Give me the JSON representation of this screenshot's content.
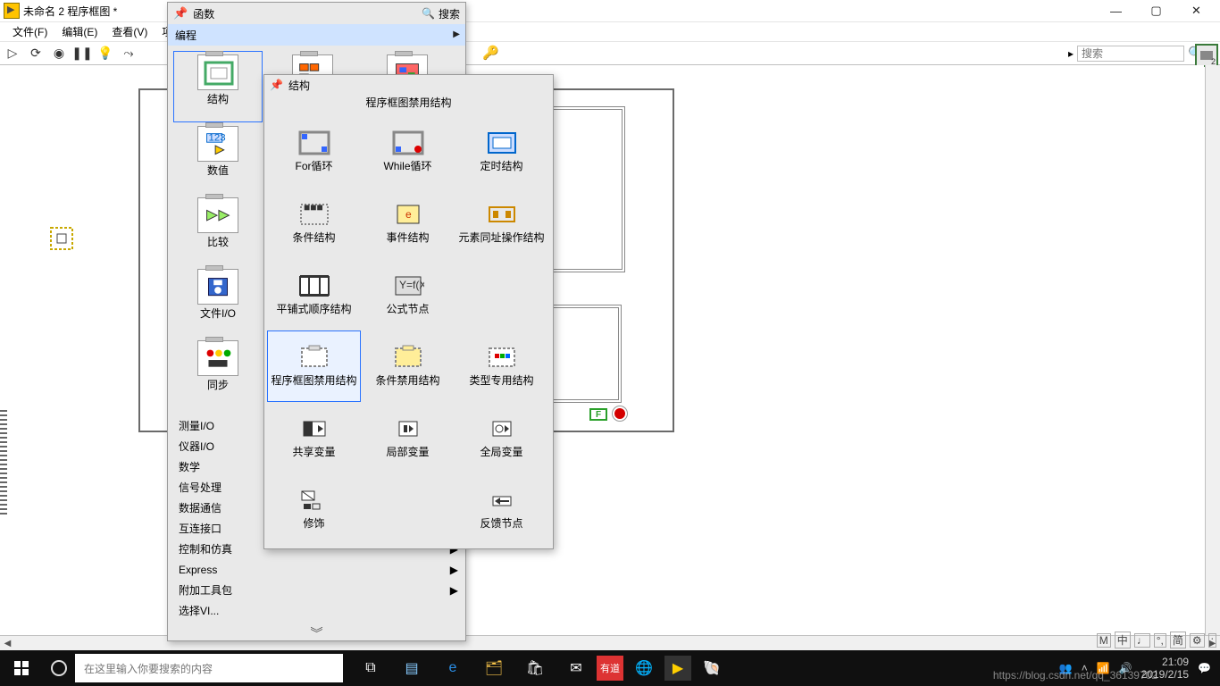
{
  "window": {
    "title": "未命名 2 程序框图 *",
    "min": "—",
    "max": "▢",
    "close": "✕"
  },
  "menubar": {
    "file": "文件(F)",
    "edit": "编辑(E)",
    "view": "查看(V)",
    "project": "项目"
  },
  "toolbar": {
    "search_placeholder": "搜索"
  },
  "palette": {
    "title": "函数",
    "search_label": "搜索",
    "programming": "编程",
    "rows": {
      "struct": "结构",
      "numeric": "数值",
      "compare": "比较",
      "fileio": "文件I/O",
      "sync": "同步"
    },
    "cats": {
      "measio": "测量I/O",
      "instrio": "仪器I/O",
      "math": "数学",
      "signal": "信号处理",
      "datacomm": "数据通信",
      "connectivity": "互连接口",
      "ctrlsim": "控制和仿真",
      "express": "Express",
      "addons": "附加工具包",
      "selectvi": "选择VI..."
    }
  },
  "subpalette": {
    "title": "结构",
    "subtitle": "程序框图禁用结构",
    "items": {
      "for": "For循环",
      "while": "While循环",
      "timed": "定时结构",
      "cond": "条件结构",
      "event": "事件结构",
      "inplace": "元素同址操作结构",
      "flatseq": "平铺式顺序结构",
      "formula": "公式节点",
      "disable": "程序框图禁用结构",
      "conddisable": "条件禁用结构",
      "typespec": "类型专用结构",
      "sharedvar": "共享变量",
      "localvar": "局部变量",
      "globalvar": "全局变量",
      "decor": "修饰",
      "feedback": "反馈节点"
    }
  },
  "diagram": {
    "f_label": "F"
  },
  "status": {
    "tokens": [
      "M",
      "中",
      "♩",
      "°,",
      "简",
      "⚙",
      ":"
    ]
  },
  "taskbar": {
    "search_placeholder": "在这里输入你要搜索的内容",
    "time": "21:09",
    "date": "2019/2/15",
    "watermark": "https://blog.csdn.net/qq_36139702"
  }
}
